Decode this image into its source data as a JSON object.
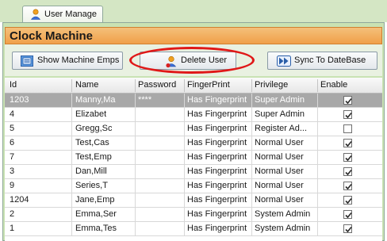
{
  "tab": {
    "label": "User Manage",
    "icon": "user-icon"
  },
  "panel": {
    "title": "Clock Machine"
  },
  "toolbar": {
    "show_emps_label": "Show Machine Emps",
    "delete_user_label": "Delete User",
    "sync_label": "Sync To DateBase"
  },
  "table": {
    "columns": [
      "Id",
      "Name",
      "Password",
      "FingerPrint",
      "Privilege",
      "Enable"
    ],
    "rows": [
      {
        "id": "1203",
        "name": "Manny,Ma",
        "password": "****",
        "fingerprint": "Has Fingerprint",
        "privilege": "Super Admin",
        "enabled": true,
        "selected": true
      },
      {
        "id": "4",
        "name": "Elizabet",
        "password": "",
        "fingerprint": "Has Fingerprint",
        "privilege": "Super Admin",
        "enabled": true
      },
      {
        "id": "5",
        "name": "Gregg,Sc",
        "password": "",
        "fingerprint": "Has Fingerprint",
        "privilege": "Register Ad...",
        "enabled": false
      },
      {
        "id": "6",
        "name": "Test,Cas",
        "password": "",
        "fingerprint": "Has Fingerprint",
        "privilege": "Normal User",
        "enabled": true
      },
      {
        "id": "7",
        "name": "Test,Emp",
        "password": "",
        "fingerprint": "Has Fingerprint",
        "privilege": "Normal User",
        "enabled": true
      },
      {
        "id": "3",
        "name": "Dan,Mill",
        "password": "",
        "fingerprint": "Has Fingerprint",
        "privilege": "Normal User",
        "enabled": true
      },
      {
        "id": "9",
        "name": "Series,T",
        "password": "",
        "fingerprint": "Has Fingerprint",
        "privilege": "Normal User",
        "enabled": true
      },
      {
        "id": "1204",
        "name": "Jane,Emp",
        "password": "",
        "fingerprint": "Has Fingerprint",
        "privilege": "Normal User",
        "enabled": true
      },
      {
        "id": "2",
        "name": "Emma,Ser",
        "password": "",
        "fingerprint": "Has Fingerprint",
        "privilege": "System Admin",
        "enabled": true
      },
      {
        "id": "1",
        "name": "Emma,Tes",
        "password": "",
        "fingerprint": "Has Fingerprint",
        "privilege": "System Admin",
        "enabled": true
      }
    ]
  },
  "colors": {
    "header_orange": "#f0a049",
    "panel_green": "#c9e2b3",
    "selected_row": "#a8a8a8",
    "annotation_red": "#e01818"
  }
}
